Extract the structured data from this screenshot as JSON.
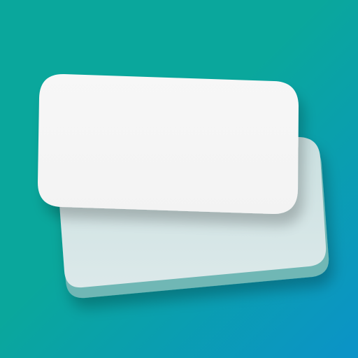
{
  "icon": {
    "name": "stacked-cards-icon",
    "colors": {
      "background_start": "#0aa79c",
      "background_end": "#0b93c8",
      "back_card_face": "#dbe9ea",
      "back_card_edge": "#6fb7b5",
      "front_card_face": "#f5f5f5",
      "shadow": "#0b5f61"
    }
  }
}
